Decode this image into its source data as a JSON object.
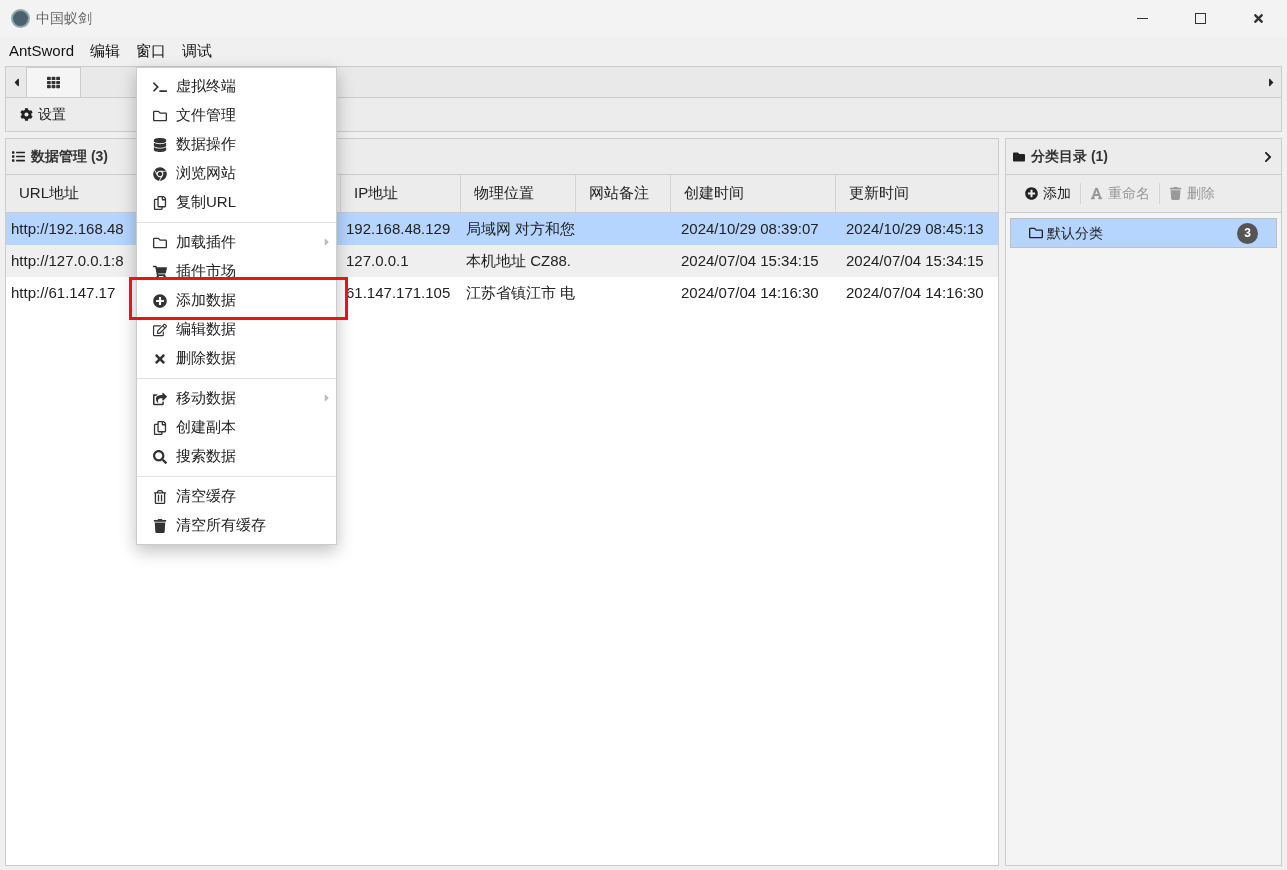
{
  "window": {
    "title": "中国蚁剑"
  },
  "menubar": [
    "AntSword",
    "编辑",
    "窗口",
    "调试"
  ],
  "toolbar": {
    "settings": "设置"
  },
  "data_panel": {
    "title": "数据管理 (3)",
    "columns": [
      "URL地址",
      "IP地址",
      "物理位置",
      "网站备注",
      "创建时间",
      "更新时间"
    ],
    "rows": [
      {
        "selected": true,
        "cells": [
          "http://192.168.48",
          "192.168.48.129",
          "局域网 对方和您",
          "",
          "2024/10/29 08:39:07",
          "2024/10/29 08:45:13"
        ]
      },
      {
        "selected": false,
        "cells": [
          "http://127.0.0.1:8",
          "127.0.0.1",
          "本机地址 CZ88.",
          "",
          "2024/07/04 15:34:15",
          "2024/07/04 15:34:15"
        ]
      },
      {
        "selected": false,
        "cells": [
          "http://61.147.17",
          "61.147.171.105",
          "江苏省镇江市 电",
          "",
          "2024/07/04 14:16:30",
          "2024/07/04 14:16:30"
        ]
      }
    ]
  },
  "category_panel": {
    "title": "分类目录 (1)",
    "buttons": [
      {
        "label": "添加",
        "disabled": false
      },
      {
        "label": "重命名",
        "disabled": true
      },
      {
        "label": "删除",
        "disabled": true
      }
    ],
    "items": [
      {
        "label": "默认分类",
        "count": "3",
        "selected": true
      }
    ]
  },
  "context_menu": {
    "groups": [
      [
        {
          "label": "虚拟终端",
          "submenu": false,
          "highlighted": false
        },
        {
          "label": "文件管理",
          "submenu": false,
          "highlighted": false
        },
        {
          "label": "数据操作",
          "submenu": false,
          "highlighted": false
        },
        {
          "label": "浏览网站",
          "submenu": false,
          "highlighted": false
        },
        {
          "label": "复制URL",
          "submenu": false,
          "highlighted": false
        }
      ],
      [
        {
          "label": "加载插件",
          "submenu": true,
          "highlighted": false
        },
        {
          "label": "插件市场",
          "submenu": false,
          "highlighted": false
        },
        {
          "label": "添加数据",
          "submenu": false,
          "highlighted": true
        },
        {
          "label": "编辑数据",
          "submenu": false,
          "highlighted": false
        },
        {
          "label": "删除数据",
          "submenu": false,
          "highlighted": false
        }
      ],
      [
        {
          "label": "移动数据",
          "submenu": true,
          "highlighted": false
        },
        {
          "label": "创建副本",
          "submenu": false,
          "highlighted": false
        },
        {
          "label": "搜索数据",
          "submenu": false,
          "highlighted": false
        }
      ],
      [
        {
          "label": "清空缓存",
          "submenu": false,
          "highlighted": false
        },
        {
          "label": "清空所有缓存",
          "submenu": false,
          "highlighted": false
        }
      ]
    ]
  }
}
